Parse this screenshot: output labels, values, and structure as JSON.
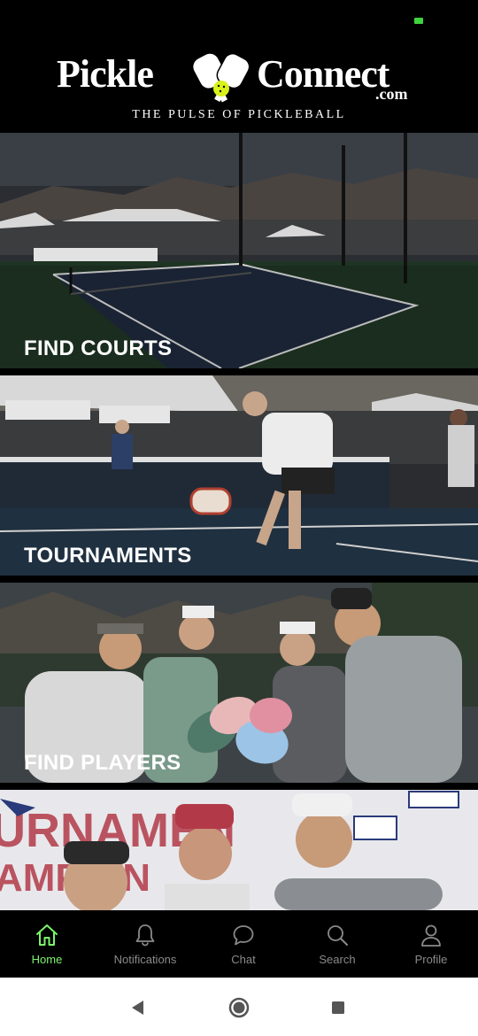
{
  "header": {
    "logo_left": "Pickle",
    "logo_right": "Connect",
    "logo_domain": ".com",
    "tagline": "THE PULSE OF PICKLEBALL"
  },
  "tiles": [
    {
      "label": "FIND COURTS",
      "image": "pickleball court at tournament venue"
    },
    {
      "label": "TOURNAMENTS",
      "image": "players competing at the net"
    },
    {
      "label": "FIND PLAYERS",
      "image": "group of players holding paddles"
    },
    {
      "label": "",
      "image": "tournament champions smiling"
    }
  ],
  "nav": {
    "items": [
      {
        "label": "Home",
        "icon": "home-icon",
        "active": true
      },
      {
        "label": "Notifications",
        "icon": "bell-icon",
        "active": false
      },
      {
        "label": "Chat",
        "icon": "chat-icon",
        "active": false
      },
      {
        "label": "Search",
        "icon": "search-icon",
        "active": false
      },
      {
        "label": "Profile",
        "icon": "profile-icon",
        "active": false
      }
    ]
  },
  "colors": {
    "accent": "#7cf36c",
    "inactive": "#8a8a8a",
    "background": "#000000"
  }
}
